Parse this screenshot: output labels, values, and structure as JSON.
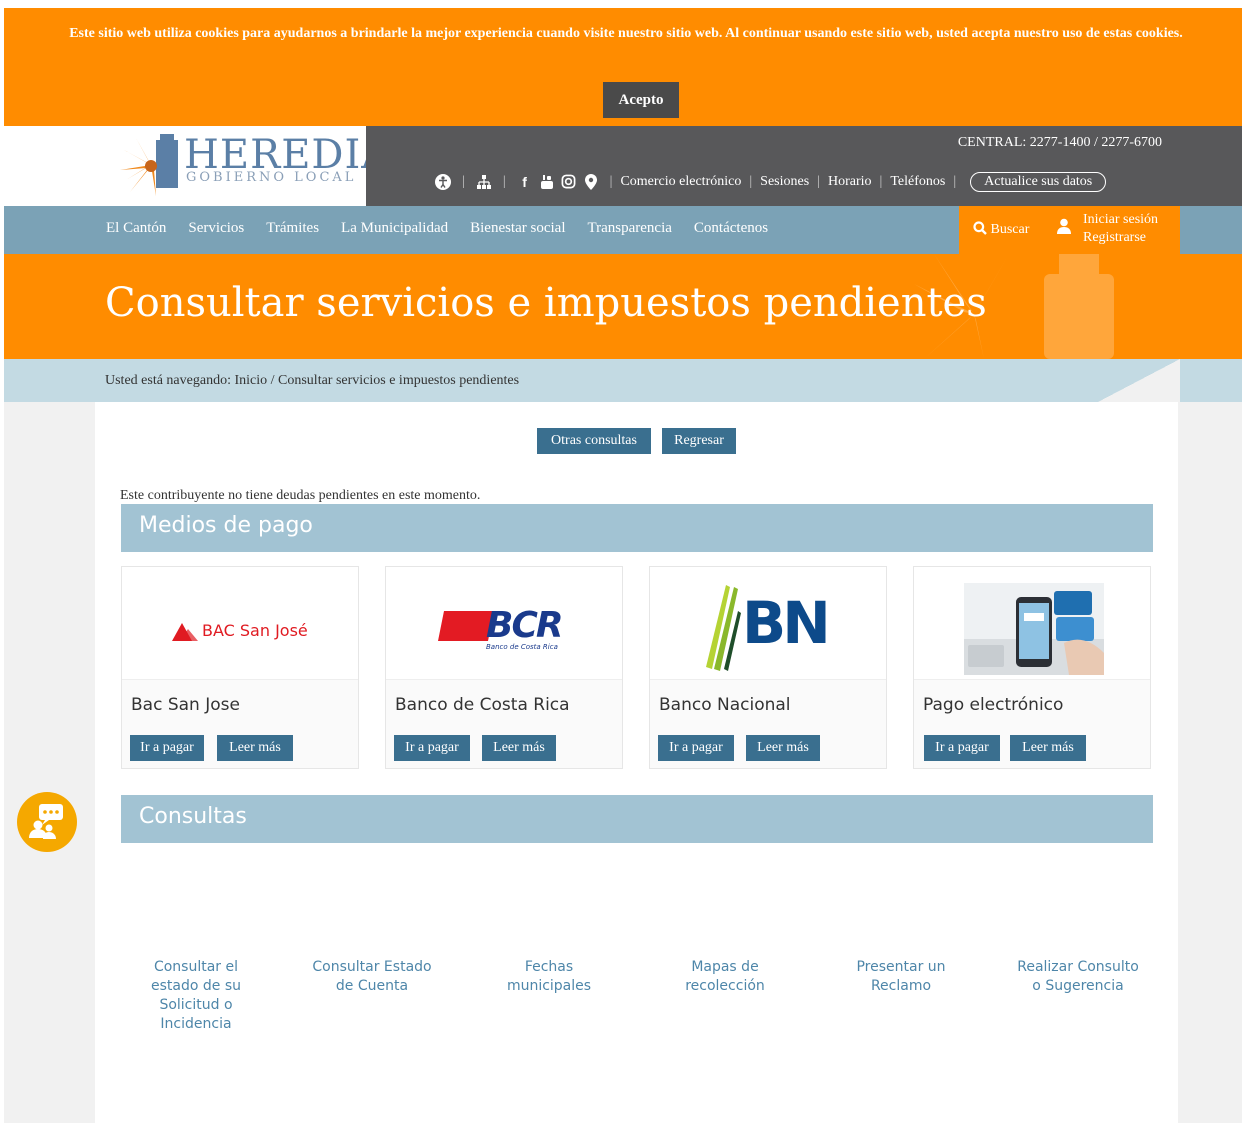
{
  "cookie_bar": {
    "message": "Este sitio web utiliza cookies para ayudarnos a brindarle la mejor experiencia cuando visite nuestro sitio web. Al continuar usando este sitio web, usted acepta nuestro uso de estas cookies.",
    "accept_label": "Acepto"
  },
  "header": {
    "logo_text": "HEREDIA",
    "logo_subtext": "GOBIERNO LOCAL",
    "central": "CENTRAL: 2277-1400 / 2277-6700",
    "links": [
      "Comercio electrónico",
      "Sesiones",
      "Horario",
      "Teléfonos"
    ],
    "update_label": "Actualice sus datos",
    "icons": [
      "accessibility-icon",
      "sitemap-icon",
      "facebook-icon",
      "youtube-icon",
      "instagram-icon",
      "location-icon"
    ]
  },
  "nav": {
    "items": [
      "El Cantón",
      "Servicios",
      "Trámites",
      "La Municipalidad",
      "Bienestar social",
      "Transparencia",
      "Contáctenos"
    ],
    "search_label": "Buscar",
    "login_label": "Iniciar sesión",
    "register_label": "Registrarse"
  },
  "hero": {
    "title": "Consultar servicios e impuestos pendientes"
  },
  "breadcrumb": {
    "prefix": "Usted está navegando:",
    "home": "Inicio",
    "current": "Consultar servicios e impuestos pendientes"
  },
  "actions": {
    "other_label": "Otras consultas",
    "back_label": "Regresar"
  },
  "notice": "Este contribuyente no tiene deudas pendientes en este momento.",
  "payment": {
    "title": "Medios de pago",
    "pay_label": "Ir a pagar",
    "more_label": "Leer más",
    "cards": [
      {
        "name": "Bac San Jose",
        "logo_text": "BAC San José"
      },
      {
        "name": "Banco de Costa Rica",
        "logo_text": "BCR",
        "logo_subtext": "Banco de Costa Rica"
      },
      {
        "name": "Banco Nacional",
        "logo_text": "BN"
      },
      {
        "name": "Pago electrónico"
      }
    ]
  },
  "consultas": {
    "title": "Consultas",
    "items": [
      "Consultar el estado de su Solicitud o Incidencia",
      "Consultar Estado de Cuenta",
      "Fechas municipales",
      "Mapas de recolección",
      "Presentar un Reclamo",
      "Realizar Consulto o Sugerencia"
    ]
  },
  "colors": {
    "orange": "#ff8c00",
    "nav_blue": "#7ba2b6",
    "dark_header": "#58585a",
    "button_blue": "#3a6f8f",
    "section_bar": "#a2c3d3"
  }
}
